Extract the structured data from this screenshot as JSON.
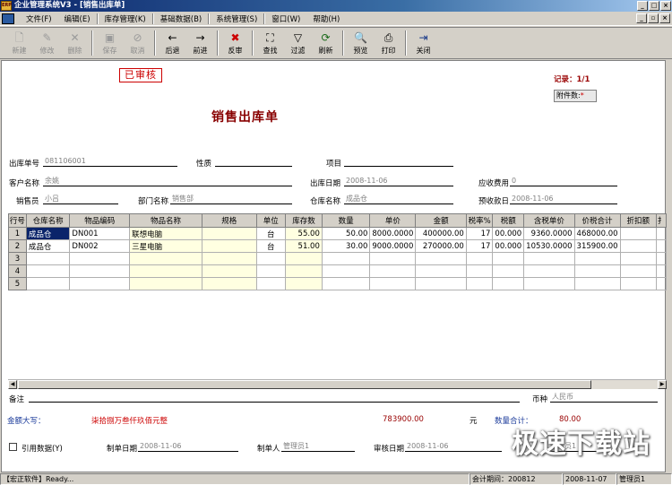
{
  "window": {
    "title": "企业管理系统V3 - [销售出库单]",
    "app_icon": "ERP"
  },
  "menu": [
    "文件(F)",
    "编辑(E)",
    "库存管理(K)",
    "基础数据(B)",
    "系统管理(S)",
    "窗口(W)",
    "帮助(H)"
  ],
  "toolbar": {
    "new": "新建",
    "edit": "修改",
    "delete": "删除",
    "save": "保存",
    "cancel": "取消",
    "back": "后退",
    "forward": "前进",
    "reverse": "反审",
    "find": "查找",
    "filter": "过滤",
    "refresh": "刷新",
    "preview": "预览",
    "print": "打印",
    "close": "关闭"
  },
  "doc": {
    "stamp": "已审核",
    "record": "记录：1/1",
    "attach_label": "附件数:",
    "attach_value": "*",
    "title": "销售出库单",
    "fields": {
      "out_no_label": "出库单号",
      "out_no": "081106001",
      "nature_label": "性质",
      "nature": "",
      "project_label": "项目",
      "project": "",
      "customer_label": "客户名称",
      "customer": "余姚",
      "out_date_label": "出库日期",
      "out_date": "2008-11-06",
      "receivable_label": "应收费用",
      "receivable": "0",
      "salesman_label": "销售员",
      "salesman": "小吕",
      "dept_label": "部门名称",
      "dept": "销售部",
      "warehouse_label": "仓库名称",
      "warehouse": "成品仓",
      "prepay_date_label": "预收款日",
      "prepay_date": "2008-11-06"
    }
  },
  "grid": {
    "headers": [
      "行号",
      "仓库名称",
      "物品编码",
      "物品名称",
      "规格",
      "单位",
      "库存数",
      "数量",
      "单价",
      "金额",
      "税率%",
      "税额",
      "含税单价",
      "价税合计",
      "折扣额",
      "扌"
    ],
    "rows": [
      [
        "1",
        "成品仓",
        "DN001",
        "联想电脑",
        "",
        "台",
        "55.00",
        "50.00",
        "8000.0000",
        "400000.00",
        "17",
        "00.000",
        "9360.0000",
        "468000.00",
        ""
      ],
      [
        "2",
        "成品仓",
        "DN002",
        "三星电脑",
        "",
        "台",
        "51.00",
        "30.00",
        "9000.0000",
        "270000.00",
        "17",
        "00.000",
        "10530.0000",
        "315900.00",
        ""
      ],
      [
        "3",
        "",
        "",
        "",
        "",
        "",
        "",
        "",
        "",
        "",
        "",
        "",
        "",
        "",
        ""
      ],
      [
        "4",
        "",
        "",
        "",
        "",
        "",
        "",
        "",
        "",
        "",
        "",
        "",
        "",
        "",
        ""
      ],
      [
        "5",
        "",
        "",
        "",
        "",
        "",
        "",
        "",
        "",
        "",
        "",
        "",
        "",
        "",
        ""
      ]
    ]
  },
  "footer": {
    "remark_label": "备注",
    "remark": "",
    "currency_label": "币种",
    "currency": "人民币",
    "amount_cn_label": "金额大写：",
    "amount_cn": "柒拾捌万叁仟玖佰元整",
    "amount": "783900.00",
    "yuan": "元",
    "qty_total_label": "数量合计：",
    "qty_total": "80.00",
    "cite_label": "引用数据(Y)",
    "make_date_label": "制单日期",
    "make_date": "2008-11-06",
    "maker_label": "制单人",
    "maker": "管理员1",
    "audit_date_label": "审核日期",
    "audit_date": "2008-11-06",
    "auditor": "管理员1"
  },
  "watermark": "极速下载站",
  "status": {
    "app": "【宏正软件】Ready...",
    "period_label": "会计期间：",
    "period": "200812",
    "date": "2008-11-07",
    "user": "管理员1"
  },
  "colors": {
    "title_bar": "#0a246a",
    "doc_title": "#880000",
    "stamp": "#cc0000",
    "amount_cn": "#cc0000",
    "selected": "#0a246a"
  }
}
